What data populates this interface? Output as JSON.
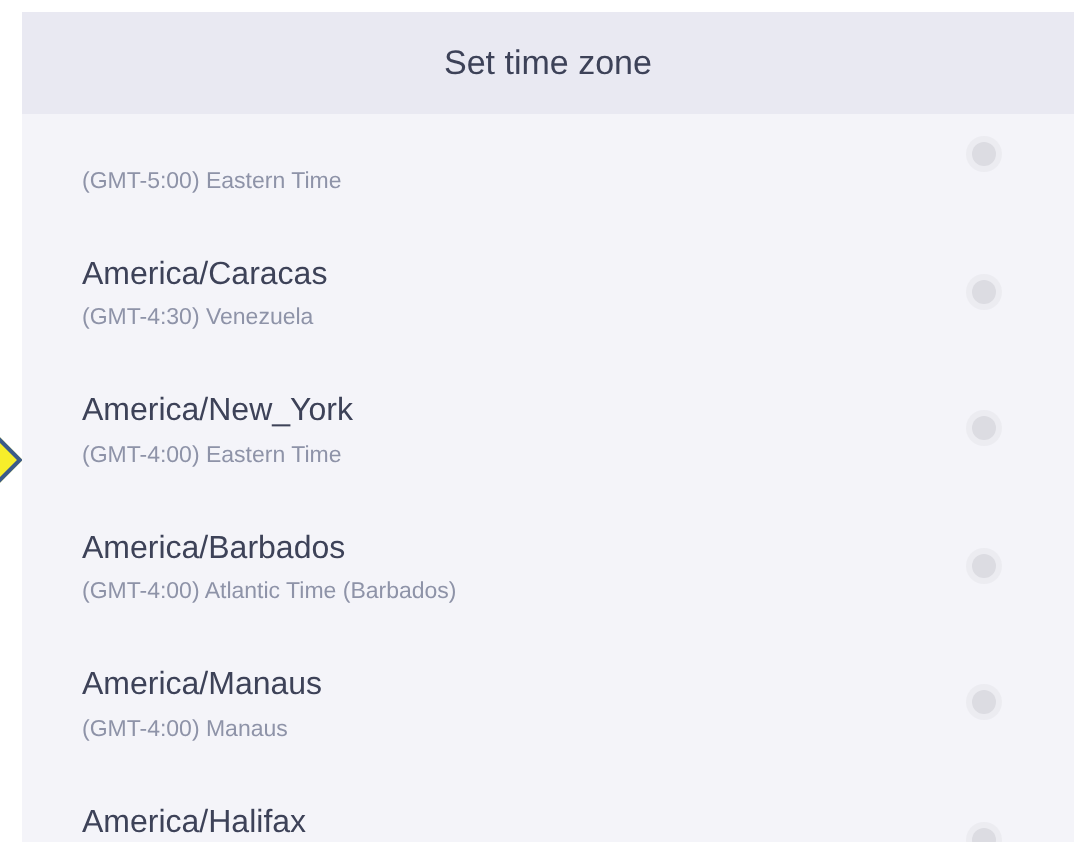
{
  "dialog": {
    "title": "Set time zone"
  },
  "time_zones": [
    {
      "subtitle": "(GMT-5:00) Eastern Time",
      "selected": false
    },
    {
      "title": "America/Caracas",
      "subtitle": "(GMT-4:30) Venezuela",
      "selected": false
    },
    {
      "title": "America/New_York",
      "subtitle": "(GMT-4:00) Eastern Time",
      "selected": false
    },
    {
      "title": "America/Barbados",
      "subtitle": "(GMT-4:00) Atlantic Time (Barbados)",
      "selected": false
    },
    {
      "title": "America/Manaus",
      "subtitle": "(GMT-4:00) Manaus",
      "selected": false
    },
    {
      "title": "America/Halifax",
      "selected": false
    }
  ]
}
